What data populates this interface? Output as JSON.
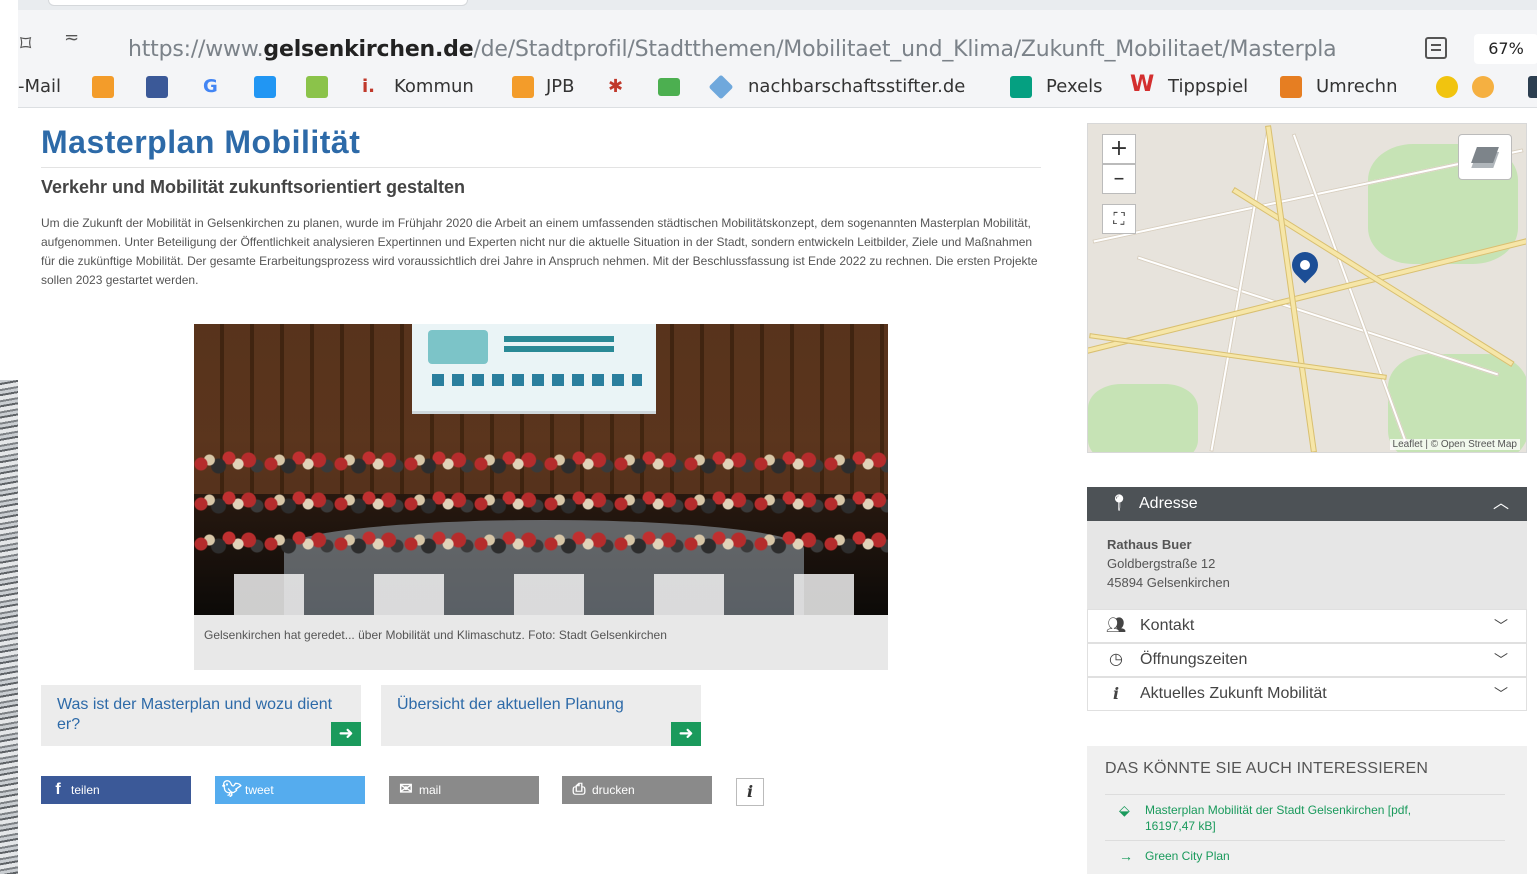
{
  "browser": {
    "url_prefix": "https://www.",
    "url_domain": "gelsenkirchen.de",
    "url_path": "/de/Stadtprofil/Stadtthemen/Mobilitaet_und_Klima/Zukunft_Mobilitaet/Masterpla",
    "zoom": "67%",
    "bookmarks": [
      {
        "label": "-Mail",
        "icon": "mail-icon"
      },
      {
        "label": "",
        "icon": "calendar-icon",
        "color": "#f39c2a"
      },
      {
        "label": "",
        "icon": "globe-icon",
        "color": "#3b5998"
      },
      {
        "label": "G",
        "icon": "google-icon",
        "color": "#4285f4"
      },
      {
        "label": "",
        "icon": "calendar-grid-icon",
        "color": "#2196f3"
      },
      {
        "label": "",
        "icon": "jb-icon",
        "color": "#8bc34a"
      },
      {
        "label": "Kommun",
        "icon": "info-icon"
      },
      {
        "label": "JPB",
        "icon": "jpb-icon"
      },
      {
        "label": "",
        "icon": "puzzle-icon"
      },
      {
        "label": "",
        "icon": "envelope-icon"
      },
      {
        "label": "nachbarschaftsstifter.de",
        "icon": "cube-icon"
      },
      {
        "label": "Pexels",
        "icon": "pexels-icon"
      },
      {
        "label": "Tippspiel",
        "icon": "w-icon"
      },
      {
        "label": "Umrechn",
        "icon": "calculator-icon"
      },
      {
        "label": "",
        "icon": "emoji-icon"
      }
    ]
  },
  "page": {
    "title": "Masterplan Mobilität",
    "subtitle": "Verkehr und Mobilität zukunftsorientiert gestalten",
    "intro": "Um die Zukunft der Mobilität in Gelsenkirchen zu planen, wurde im Frühjahr 2020 die Arbeit an einem umfassenden städtischen Mobilitätskonzept, dem sogenannten Masterplan Mobilität, aufgenommen. Unter Beteiligung der Öffentlichkeit analysieren Expertinnen und Experten nicht nur die aktuelle Situation in der Stadt, sondern entwickeln Leitbilder, Ziele und Maßnahmen für die zukünftige Mobilität. Der gesamte Erarbeitungsprozess wird voraussichtlich drei Jahre in Anspruch nehmen. Mit der Beschlussfassung ist Ende 2022 zu rechnen. Die ersten Projekte sollen 2023 gestartet werden.",
    "caption": "Gelsenkirchen hat geredet... über Mobilität und Klimaschutz. Foto: Stadt Gelsenkirchen",
    "teasers": [
      {
        "label": "Was ist der Masterplan und wozu dient er?"
      },
      {
        "label": "Übersicht der aktuellen Planung"
      }
    ],
    "share": [
      {
        "label": "teilen",
        "icon": "f",
        "color": "#3b5998"
      },
      {
        "label": "tweet",
        "icon": "t",
        "color": "#55acee"
      },
      {
        "label": "mail",
        "icon": "✉",
        "color": "#8a8a8a"
      },
      {
        "label": "drucken",
        "icon": "⎙",
        "color": "#8a8a8a"
      }
    ],
    "info_button": "i"
  },
  "sidebar": {
    "map": {
      "zoom_in": "+",
      "zoom_out": "–",
      "fullscreen": "⛶",
      "attribution": "Leaflet | © Open Street Map"
    },
    "address": {
      "heading": "Adresse",
      "line1": "Rathaus Buer",
      "line2": "Goldbergstraße 12",
      "line3": "45894 Gelsenkirchen"
    },
    "accordions": [
      {
        "label": "Kontakt",
        "icon": "contact-icon"
      },
      {
        "label": "Öffnungszeiten",
        "icon": "clock-icon"
      },
      {
        "label": "Aktuelles Zukunft Mobilität",
        "icon": "info-icon"
      }
    ],
    "related": {
      "title": "DAS KÖNNTE SIE AUCH INTERESSIEREN",
      "items": [
        {
          "label": "Masterplan Mobilität der Stadt Gelsenkirchen [pdf, 16197,47 kB]"
        },
        {
          "label": "Green City Plan"
        }
      ]
    }
  },
  "colors": {
    "title": "#2d6aa8",
    "teaser_arrow": "#1a9a5c",
    "address_header": "#4d5256",
    "related_link": "#1a9a5c"
  }
}
